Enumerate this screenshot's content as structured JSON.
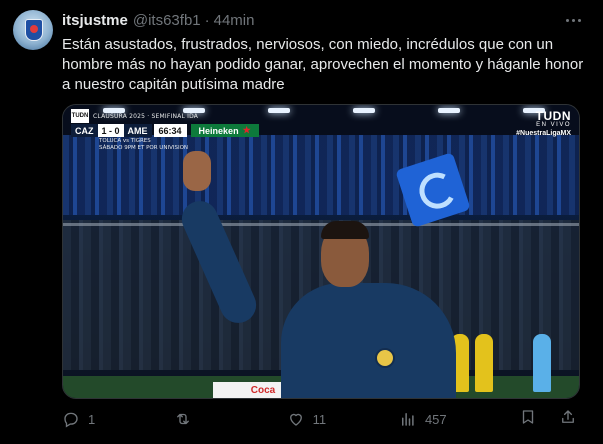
{
  "post": {
    "display_name": "itsjustme",
    "handle": "@its63fb1",
    "separator": "·",
    "time": "44min",
    "text": "Están asustados, frustrados, nerviosos, con miedo, incrédulos que con un hombre más no hayan podido ganar, aprovechen el momento y háganle honor a nuestro capitán putísima madre"
  },
  "media": {
    "overlay": {
      "broadcaster_logo": "TUDN",
      "caption": "CLAUSURA 2025 · SEMIFINAL IDA",
      "home_team": "CAZ",
      "score": "1 - 0",
      "away_team": "AME",
      "clock": "66:34",
      "sponsor": "Heineken",
      "sub_line_1": "TOLUCA vs TIGRES",
      "sub_line_2": "SÁBADO 9PM ET POR UNIVISION",
      "corner_logo": "TUDN",
      "corner_live": "EN VIVO",
      "corner_hashtag": "#NuestraLigaMX"
    }
  },
  "actions": {
    "reply_count": "1",
    "repost_count": "",
    "like_count": "11",
    "views_count": "457"
  },
  "icons": {
    "more": "more-icon",
    "reply": "reply-icon",
    "repost": "repost-icon",
    "like": "heart-icon",
    "views": "views-icon",
    "bookmark": "bookmark-icon",
    "share": "share-icon"
  },
  "colors": {
    "background": "#000000",
    "text_primary": "#e7e9ea",
    "text_secondary": "#71767b",
    "border": "#2f3336"
  }
}
